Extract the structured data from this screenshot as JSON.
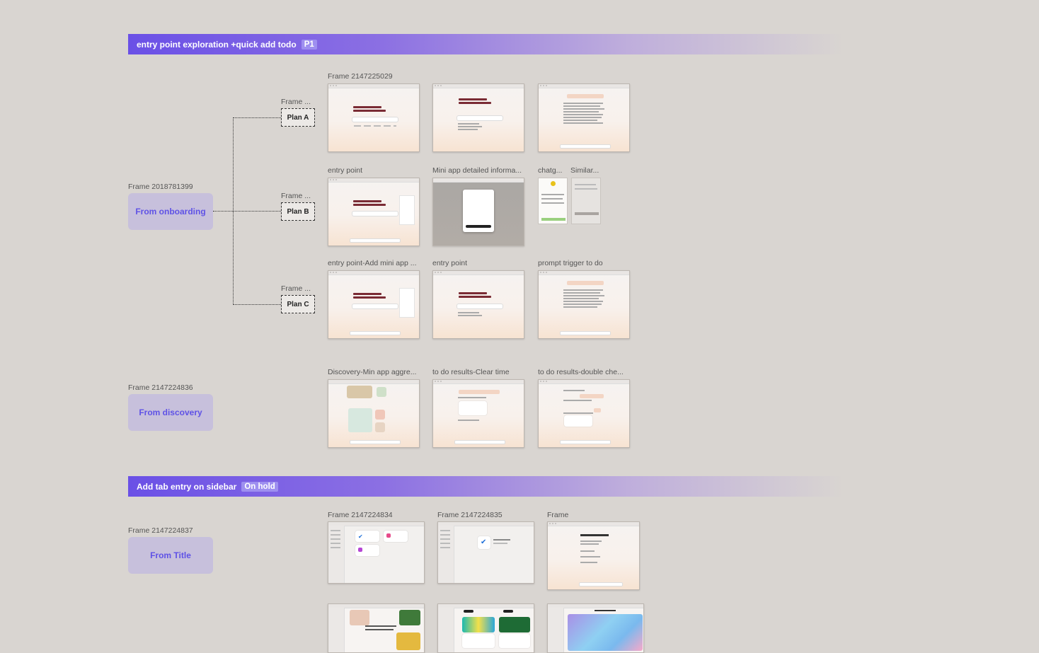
{
  "sections": [
    {
      "title": "entry point exploration +quick add todo",
      "tag": "P1"
    },
    {
      "title": "Add tab entry on sidebar",
      "tag": "On hold"
    }
  ],
  "sources": {
    "onboarding": {
      "frame": "Frame 2018781399",
      "label": "From onboarding"
    },
    "discovery": {
      "frame": "Frame 2147224836",
      "label": "From discovery"
    },
    "title": {
      "frame": "Frame 2147224837",
      "label": "From Title"
    }
  },
  "plans": [
    {
      "frame": "Frame ...",
      "label": "Plan A"
    },
    {
      "frame": "Frame ...",
      "label": "Plan B"
    },
    {
      "frame": "Frame ...",
      "label": "Plan C"
    }
  ],
  "thumb_labels": {
    "row_a": [
      "Frame 2147225029"
    ],
    "row_b": [
      "entry point",
      "Mini app detailed informa...",
      "chatg...",
      "Similar..."
    ],
    "row_c": [
      "entry point-Add mini app ...",
      "entry point",
      "prompt trigger to do"
    ],
    "row_d": [
      "Discovery-Min app aggre...",
      "to do results-Clear time",
      "to do results-double che..."
    ],
    "row_e": [
      "Frame 2147224834",
      "Frame 2147224835",
      "Frame"
    ]
  },
  "thumb_text": {
    "copilot_hello": "Hello, I'm Copilot",
    "copilot_mind": "What's on your mind today?",
    "ask_copilot": "Ask Copilot",
    "hey_taylor": "Hey Taylor, how can I help?",
    "microsoft_to_do": "Microsoft To Do",
    "copilot_labs": "Copilot Labs features are experimental AI initiatives",
    "copilot_podcasts": "Copilot Podcasts",
    "think_deeper": "Think Deeper",
    "copilot_notebooks": "Copilot Notebooks"
  },
  "colors": {
    "banner_start": "#6a50e6",
    "source_bg": "#c7c0dc",
    "source_text": "#5f52e6",
    "canvas": "#d9d5d1"
  }
}
